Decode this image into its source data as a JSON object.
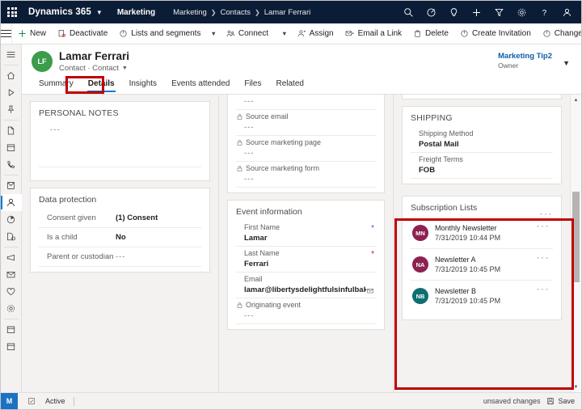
{
  "topbar": {
    "waffle_label": "app-launcher",
    "brand": "Dynamics 365",
    "app_name": "Marketing",
    "breadcrumb": [
      "Marketing",
      "Contacts",
      "Lamar Ferrari"
    ],
    "icons": [
      "search-icon",
      "assistant-icon",
      "lightbulb-icon",
      "add-icon",
      "filter-icon",
      "settings-icon",
      "help-icon",
      "account-icon"
    ]
  },
  "commandbar": {
    "new": "New",
    "deactivate": "Deactivate",
    "lists_and_segments": "Lists and segments",
    "connect": "Connect",
    "assign": "Assign",
    "email_a_link": "Email a Link",
    "delete": "Delete",
    "create_invitation": "Create Invitation",
    "change_password": "Change Password",
    "overflow": "···"
  },
  "rail": {
    "items": [
      "hamburger-menu-icon",
      "home-icon",
      "recent-icon",
      "pinned-icon",
      "document-icon",
      "calendar-icon",
      "phone-icon",
      "activity-icon",
      "contacts-icon",
      "segments-icon",
      "forms-icon",
      "campaign-icon",
      "email-icon",
      "favorites-icon",
      "lifecycle-icon",
      "events-icon",
      "sessions-icon"
    ],
    "selected_index": 8
  },
  "record": {
    "avatar_initials": "LF",
    "avatar_color": "#3b9c4a",
    "title": "Lamar Ferrari",
    "subtitle": "Contact · Contact",
    "owner_name": "Marketing Tip2",
    "owner_role": "Owner",
    "tabs": [
      {
        "label": "Summary",
        "active": false
      },
      {
        "label": "Details",
        "active": true
      },
      {
        "label": "Insights",
        "active": false
      },
      {
        "label": "Events attended",
        "active": false
      },
      {
        "label": "Files",
        "active": false
      },
      {
        "label": "Related",
        "active": false
      }
    ]
  },
  "columns": {
    "personal_notes": {
      "title": "PERSONAL NOTES",
      "value": "---"
    },
    "data_protection": {
      "title": "Data protection",
      "rows": [
        {
          "label": "Consent given",
          "value": "(1) Consent",
          "dashes": false
        },
        {
          "label": "Is a child",
          "value": "No",
          "dashes": false
        },
        {
          "label": "Parent or custodian",
          "value": "---",
          "dashes": true
        }
      ]
    },
    "source_card": {
      "top_value": "---",
      "fields": [
        {
          "label": "Source email",
          "value": "---",
          "lock": true
        },
        {
          "label": "Source marketing page",
          "value": "---",
          "lock": true
        },
        {
          "label": "Source marketing form",
          "value": "---",
          "lock": true
        }
      ]
    },
    "event_information": {
      "title": "Event information",
      "fields": [
        {
          "label": "First Name",
          "value": "Lamar",
          "required": "blue",
          "lock": false
        },
        {
          "label": "Last Name",
          "value": "Ferrari",
          "required": "red",
          "lock": false
        },
        {
          "label": "Email",
          "value": "lamar@libertysdelightfulsinfulbakeryandcaf...",
          "required": "",
          "lock": false,
          "trailing_icon": "email-open-icon"
        },
        {
          "label": "Originating event",
          "value": "---",
          "required": "",
          "lock": true
        }
      ]
    },
    "shipping": {
      "title": "SHIPPING",
      "fields": [
        {
          "label": "Shipping Method",
          "value": "Postal Mail"
        },
        {
          "label": "Freight Terms",
          "value": "FOB"
        }
      ]
    },
    "subscription_lists": {
      "title": "Subscription Lists",
      "overflow": "···",
      "items": [
        {
          "initials": "MN",
          "color": "#8c2250",
          "name": "Monthly Newsletter",
          "date": "7/31/2019 10:44 PM",
          "overflow": "···"
        },
        {
          "initials": "NA",
          "color": "#8c2250",
          "name": "Newsletter A",
          "date": "7/31/2019 10:45 PM",
          "overflow": "···"
        },
        {
          "initials": "NB",
          "color": "#0f6e72",
          "name": "Newsletter B",
          "date": "7/31/2019 10:45 PM",
          "overflow": "···"
        }
      ]
    }
  },
  "statusbar": {
    "app_badge": "M",
    "state": "Active",
    "unsaved": "unsaved changes",
    "save": "Save"
  },
  "highlight_color": "#c00000"
}
